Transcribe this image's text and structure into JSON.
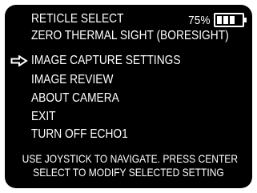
{
  "battery": {
    "percent_label": "75%",
    "level": 0.75,
    "icon": "battery-icon"
  },
  "menu": {
    "selected_index": 2,
    "pointer_icon": "arrow-right-icon",
    "items": [
      {
        "label": "RETICLE SELECT"
      },
      {
        "label": "ZERO THERMAL SIGHT (BORESIGHT)"
      },
      {
        "label": "IMAGE CAPTURE SETTINGS"
      },
      {
        "label": "IMAGE REVIEW"
      },
      {
        "label": "ABOUT CAMERA"
      },
      {
        "label": "EXIT"
      },
      {
        "label": "TURN OFF ECHO1"
      }
    ]
  },
  "help": {
    "line1": "USE JOYSTICK TO NAVIGATE. PRESS CENTER",
    "line2": "SELECT TO MODIFY SELECTED SETTING"
  },
  "colors": {
    "screen_background": "#000000",
    "text": "#ffffff",
    "bezel": "#ffffff"
  }
}
